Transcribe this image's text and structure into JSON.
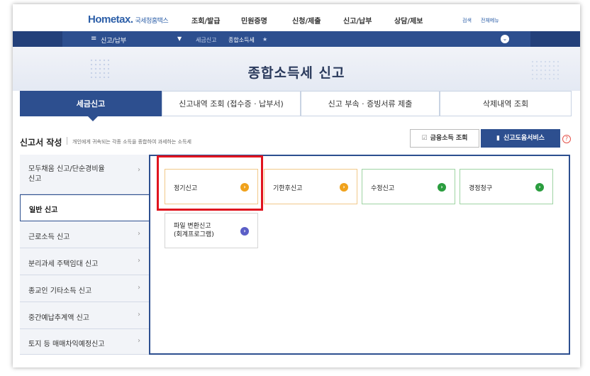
{
  "topnav": {
    "logo_main": "Hometax.",
    "logo_sub": "국세청홈택스",
    "menu": [
      "조회/발급",
      "민원증명",
      "신청/제출",
      "신고/납부",
      "상담/제보"
    ],
    "search": "검색",
    "all_menu": "전체메뉴"
  },
  "bluebar": {
    "menu_label": "신고/납부",
    "breadcrumb": [
      "세금신고",
      "종합소득세"
    ],
    "star": "★"
  },
  "hero": {
    "title": "종합소득세 신고"
  },
  "tabs": [
    {
      "label": "세금신고",
      "active": true
    },
    {
      "label": "신고내역 조회 (접수증 · 납부서)"
    },
    {
      "label": "신고 부속 · 증빙서류 제출"
    },
    {
      "label": "삭제내역 조회"
    }
  ],
  "section": {
    "title": "신고서 작성",
    "description": "개인에게 귀속되는 각종 소득을 종합하여 과세하는 소득세",
    "finance_button": "금융소득 조회",
    "help_button": "신고도움서비스",
    "help_q": "?"
  },
  "sidebar": {
    "items": [
      {
        "label": "모두채움 신고/단순경비율 신고",
        "line1": "모두채움 신고/단순경비율",
        "line2": "신고"
      },
      {
        "label": "일반 신고",
        "active": true
      },
      {
        "label": "근로소득 신고"
      },
      {
        "label": "분리과세 주택임대 신고"
      },
      {
        "label": "종교인 기타소득 신고"
      },
      {
        "label": "중간예납추계액 신고"
      },
      {
        "label": "토지 등 매매차익예정신고"
      }
    ],
    "chevron": "›"
  },
  "cards": [
    {
      "label": "정기신고",
      "color": "#f0a21c"
    },
    {
      "label": "기한후신고",
      "color": "#f0a21c"
    },
    {
      "label": "수정신고",
      "color": "#2a9d3e"
    },
    {
      "label": "경정청구",
      "color": "#2a9d3e"
    },
    {
      "line1": "파일 변환신고",
      "line2": "(회계프로그램)",
      "color": "#5b5fc7"
    }
  ],
  "card_arrow": "›",
  "colors": {
    "primary": "#2d4f8f",
    "highlight": "#e0141e"
  }
}
